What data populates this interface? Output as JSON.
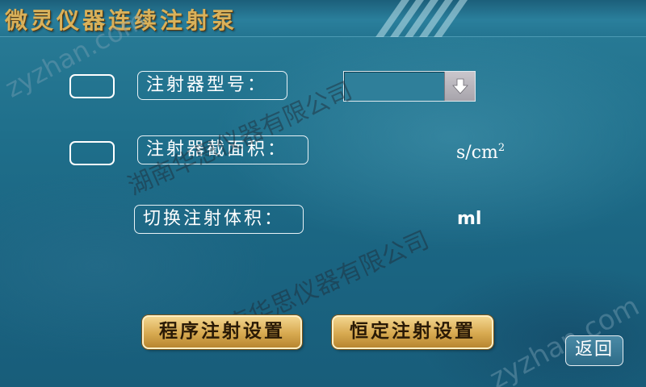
{
  "header": {
    "title": "微灵仪器连续注射泵"
  },
  "watermarks": {
    "site_1": "zyzhan.com",
    "site_2": "zyzhan.com",
    "company_1": "湖南华思仪器有限公司",
    "company_2": "湖南华思仪器有限公司"
  },
  "form": {
    "syringe_model_label": "注射器型号：",
    "syringe_model_value": "",
    "cross_section_label": "注射器截面积：",
    "cross_section_unit": "s/cm",
    "cross_section_unit_exp": "2",
    "switch_volume_label": "切换注射体积：",
    "switch_volume_unit": "ml"
  },
  "buttons": {
    "program_injection": "程序注射设置",
    "constant_injection": "恒定注射设置",
    "back": "返回"
  },
  "colors": {
    "title_gold": "#d9b15a",
    "button_gold": "#d7a950",
    "background_teal": "#1f6f8b"
  },
  "icons": {
    "dropdown": "arrow-down-icon"
  }
}
